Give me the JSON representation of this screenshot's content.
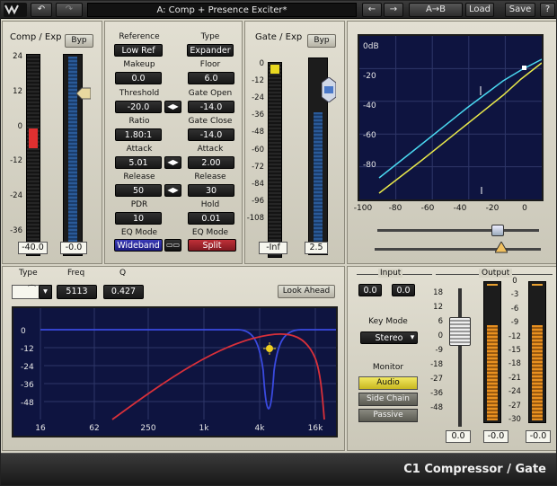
{
  "topbar": {
    "preset_name": "A: Comp + Presence Exciter*",
    "ab_label": "A→B",
    "load_label": "Load",
    "save_label": "Save",
    "help_label": "?"
  },
  "comp": {
    "title": "Comp / Exp",
    "bypass_label": "Byp",
    "scale": [
      "24",
      "12",
      "0",
      "-12",
      "-24",
      "-36"
    ],
    "in_value": "-40.0",
    "thr_value": "-0.0"
  },
  "params": {
    "reference_label": "Reference",
    "reference_value": "Low Ref",
    "type_label": "Type",
    "type_value": "Expander",
    "makeup_label": "Makeup",
    "makeup_value": "0.0",
    "floor_label": "Floor",
    "floor_value": "6.0",
    "threshold_label": "Threshold",
    "threshold_value": "-20.0",
    "gate_open_label": "Gate Open",
    "gate_open_value": "-14.0",
    "ratio_label": "Ratio",
    "ratio_value": "1.80:1",
    "gate_close_label": "Gate Close",
    "gate_close_value": "-14.0",
    "attack_label": "Attack",
    "attack_value": "5.01",
    "gattack_label": "Attack",
    "gattack_value": "2.00",
    "release_label": "Release",
    "release_value": "50",
    "grelease_label": "Release",
    "grelease_value": "30",
    "pdr_label": "PDR",
    "pdr_value": "10",
    "hold_label": "Hold",
    "hold_value": "0.01",
    "eqmode1_label": "EQ Mode",
    "eqmode1_value": "Wideband",
    "eqmode2_label": "EQ Mode",
    "eqmode2_value": "Split"
  },
  "gate": {
    "title": "Gate / Exp",
    "bypass_label": "Byp",
    "scale": [
      "-108",
      "-96",
      "-84",
      "-72",
      "-60",
      "-48",
      "-36",
      "-24",
      "-12",
      "0"
    ],
    "in_value": "-Inf",
    "thr_value": "2.5"
  },
  "graph": {
    "y_ticks": [
      "0dB",
      "-20",
      "-40",
      "-60",
      "-80"
    ],
    "x_ticks": [
      "-100",
      "-80",
      "-60",
      "-40",
      "-20",
      "0"
    ],
    "colors": {
      "line1": "#4ad8f0",
      "line2": "#e8e84a"
    }
  },
  "eq": {
    "type_label": "Type",
    "freq_label": "Freq",
    "q_label": "Q",
    "freq_value": "5113",
    "q_value": "0.427",
    "lookahead_label": "Look Ahead",
    "y_ticks": [
      "0",
      "-12",
      "-24",
      "-36",
      "-48"
    ],
    "x_ticks": [
      "16",
      "62",
      "250",
      "1k",
      "4k",
      "16k"
    ]
  },
  "io": {
    "input_label": "Input",
    "input_l": "0.0",
    "input_r": "0.0",
    "keymode_label": "Key Mode",
    "keymode_value": "Stereo",
    "monitor_label": "Monitor",
    "monitor_audio": "Audio",
    "monitor_sidechain": "Side Chain",
    "monitor_passive": "Passive",
    "output_label": "Output",
    "fader_scale": [
      "18",
      "12",
      "6",
      "0",
      "-9",
      "-18",
      "-27",
      "-36",
      "-48"
    ],
    "meter_scale": [
      "0",
      "-3",
      "-6",
      "-9",
      "-12",
      "-15",
      "-18",
      "-21",
      "-24",
      "-27",
      "-30"
    ],
    "output_value": "0.0",
    "peak_l": "-0.0",
    "peak_r": "-0.0"
  },
  "footer": {
    "product": "C1 Compressor / Gate"
  }
}
